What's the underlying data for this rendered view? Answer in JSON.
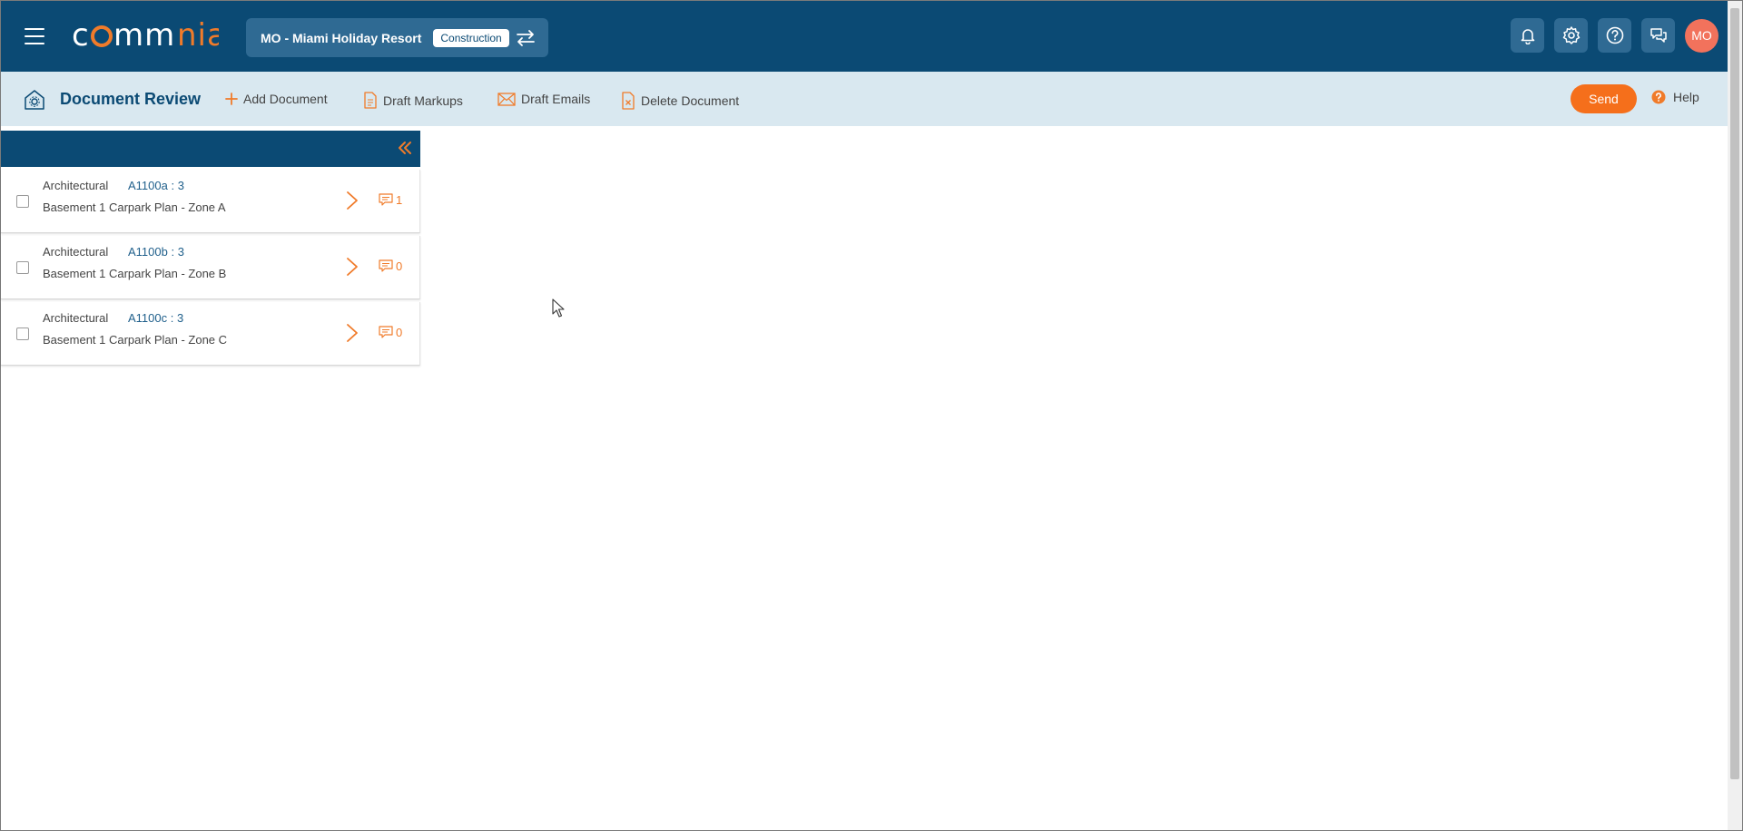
{
  "header": {
    "logo_text": "commnia",
    "project_name": "MO - Miami Holiday Resort",
    "project_stage": "Construction",
    "avatar_initials": "MO",
    "icons": [
      "menu-icon",
      "swap-icon",
      "bell-icon",
      "gear-icon",
      "help-icon",
      "chat-icon"
    ]
  },
  "toolbar": {
    "title": "Document Review",
    "add_document": "Add Document",
    "draft_markups": "Draft Markups",
    "draft_emails": "Draft Emails",
    "delete_document": "Delete Document",
    "send": "Send",
    "help": "Help"
  },
  "documents": [
    {
      "discipline": "Architectural",
      "code": "A1100a : 3",
      "title": "Basement 1 Carpark Plan - Zone A",
      "comments": "1"
    },
    {
      "discipline": "Architectural",
      "code": "A1100b : 3",
      "title": "Basement 1 Carpark Plan - Zone B",
      "comments": "0"
    },
    {
      "discipline": "Architectural",
      "code": "A1100c : 3",
      "title": "Basement 1 Carpark Plan - Zone C",
      "comments": "0"
    }
  ],
  "colors": {
    "primary": "#0b4a74",
    "accent": "#f56f1b",
    "toolbar_bg": "#d9e8f0",
    "avatar": "#f2725c"
  }
}
